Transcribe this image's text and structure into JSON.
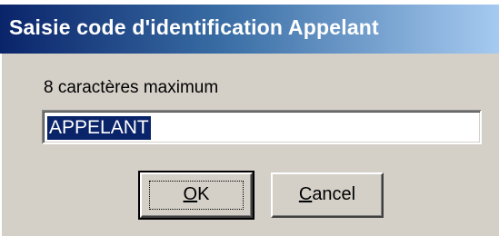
{
  "window": {
    "title": "Saisie code d'identification Appelant"
  },
  "form": {
    "hint": "8 caractères maximum",
    "field_value": "APPELANT"
  },
  "buttons": {
    "ok": {
      "accel": "O",
      "rest": "K"
    },
    "cancel": {
      "accel": "C",
      "rest": "ancel"
    }
  },
  "colors": {
    "titlebar_start": "#0a246a",
    "titlebar_end": "#a6caf0",
    "dialog_face": "#d4d0c8",
    "selection": "#0a246a"
  }
}
